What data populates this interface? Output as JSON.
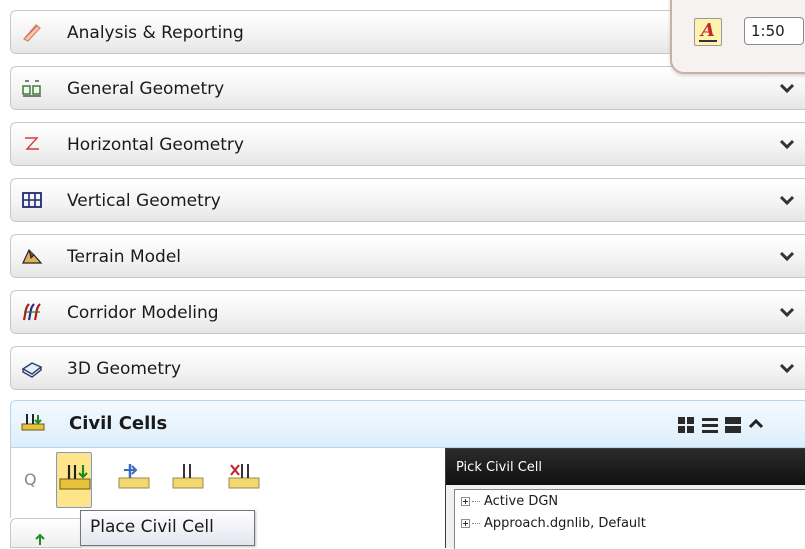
{
  "panels": [
    {
      "label": "Analysis & Reporting",
      "icon": "analysis-reporting-icon"
    },
    {
      "label": "General Geometry",
      "icon": "general-geometry-icon"
    },
    {
      "label": "Horizontal Geometry",
      "icon": "horizontal-geometry-icon"
    },
    {
      "label": "Vertical Geometry",
      "icon": "vertical-geometry-icon"
    },
    {
      "label": "Terrain Model",
      "icon": "terrain-model-icon"
    },
    {
      "label": "Corridor Modeling",
      "icon": "corridor-modeling-icon"
    },
    {
      "label": "3D Geometry",
      "icon": "3d-geometry-icon"
    }
  ],
  "civil_cells": {
    "label": "Civil Cells",
    "search_glyph": "Q",
    "tools": [
      "place-civil-cell-icon",
      "place-civil-cell-alt-icon",
      "civil-cell-icon",
      "delete-civil-cell-icon"
    ],
    "view_icons": [
      "grid-view-icon",
      "list-view-icon",
      "large-icon-view-icon",
      "collapse-icon"
    ]
  },
  "tooltip": {
    "text": "Place Civil Cell"
  },
  "pick_dialog": {
    "title": "Pick Civil Cell",
    "items": [
      "Active DGN",
      "Approach.dgnlib, Default"
    ]
  },
  "overlay_toolbar": {
    "text_style_glyph": "A",
    "scale": "1:50"
  },
  "colors": {
    "selected_tool": "#ffe58a",
    "civil_header": "#ddeefb"
  }
}
